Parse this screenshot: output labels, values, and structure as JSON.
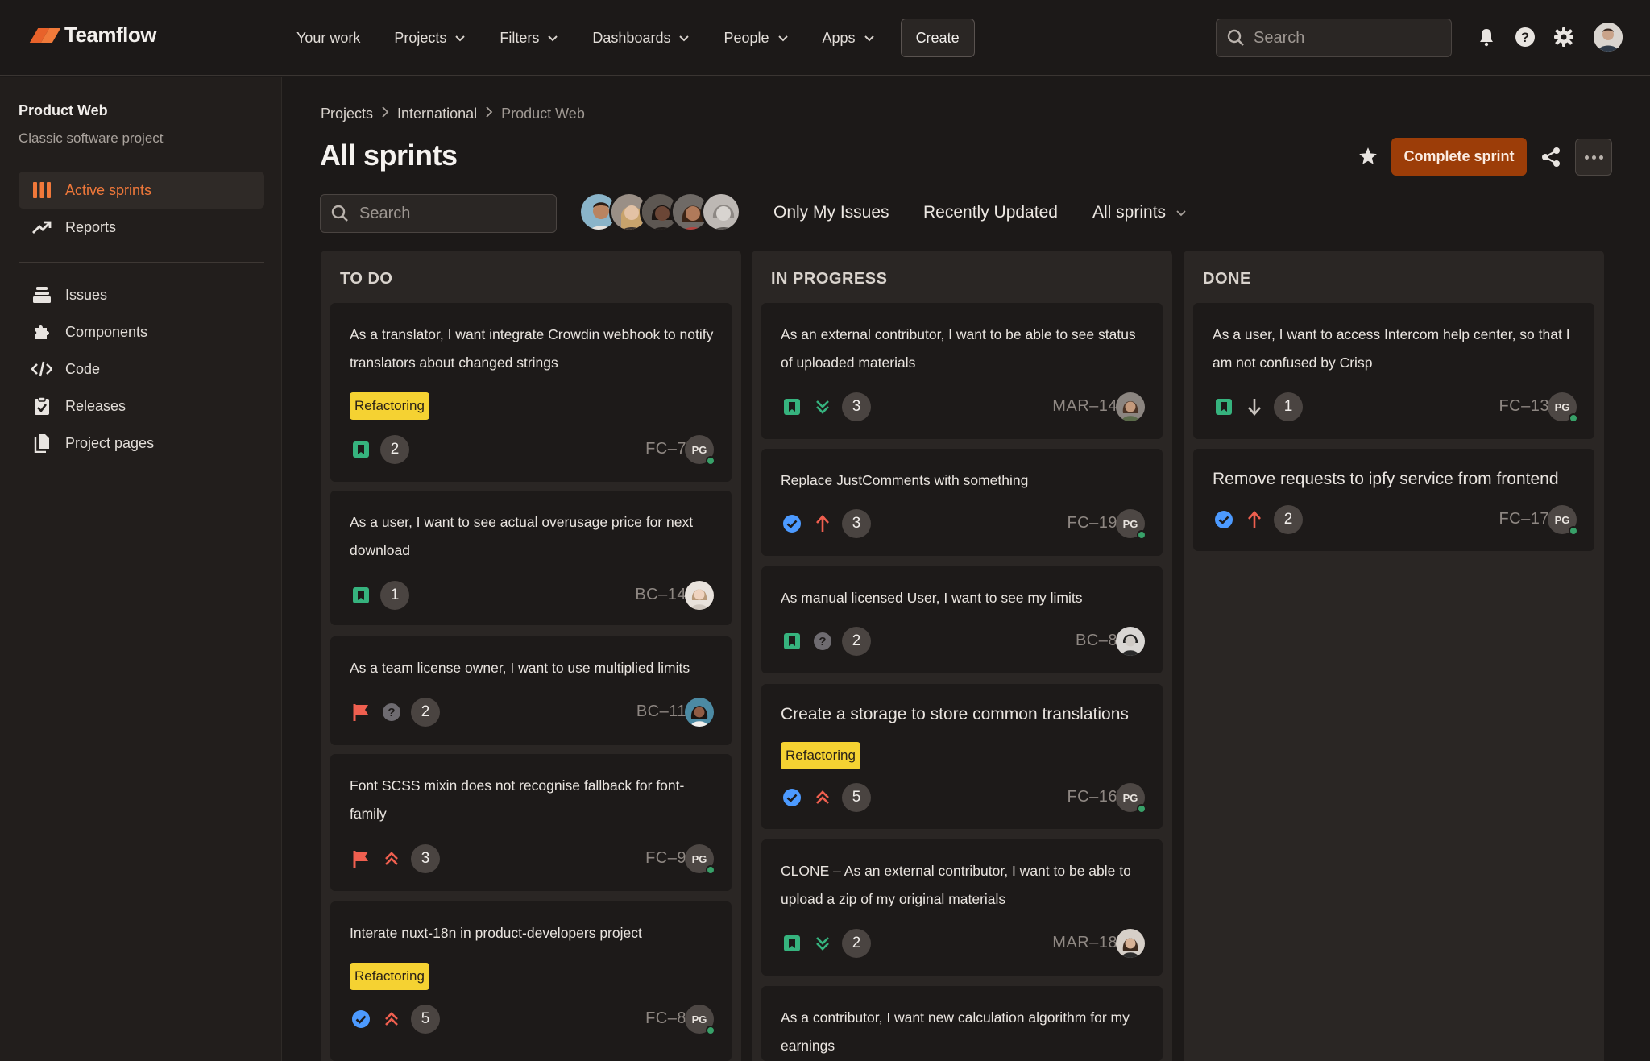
{
  "app": {
    "name": "Teamflow"
  },
  "nav": {
    "items": [
      {
        "label": "Your work"
      },
      {
        "label": "Projects"
      },
      {
        "label": "Filters"
      },
      {
        "label": "Dashboards"
      },
      {
        "label": "People"
      },
      {
        "label": "Apps"
      }
    ],
    "create_label": "Create",
    "search_placeholder": "Search"
  },
  "sidebar": {
    "project_name": "Product Web",
    "project_type": "Classic software project",
    "items": [
      {
        "label": "Active sprints",
        "icon": "board-columns-icon",
        "active": true
      },
      {
        "label": "Reports",
        "icon": "trend-up-icon"
      },
      {
        "label": "Issues",
        "icon": "stack-icon"
      },
      {
        "label": "Components",
        "icon": "puzzle-icon"
      },
      {
        "label": "Code",
        "icon": "code-icon"
      },
      {
        "label": "Releases",
        "icon": "clipboard-check-icon"
      },
      {
        "label": "Project pages",
        "icon": "pages-icon"
      }
    ]
  },
  "breadcrumb": [
    "Projects",
    "International",
    "Product Web"
  ],
  "page": {
    "title": "All sprints",
    "complete_label": "Complete sprint",
    "search_placeholder": "Search",
    "filters": {
      "only_my_issues": "Only My Issues",
      "recently_updated": "Recently Updated",
      "sprints_select": "All sprints"
    }
  },
  "colors": {
    "accent": "#e8622a",
    "complete_button": "#9c3d08",
    "tag": "#f5d232",
    "story": "#36b37e",
    "task": "#4c9aff",
    "bug": "#ef5f4f",
    "online": "#38a169"
  },
  "columns": [
    {
      "title": "TO DO",
      "cards": [
        {
          "title": "As a translator, I want integrate Crowdin webhook to notify translators about changed strings",
          "tag": "Refactoring",
          "type": "story",
          "priority": "",
          "count": "2",
          "key": "FC–7",
          "assignee": "PG"
        },
        {
          "title": "As a user, I want to see actual overusage price for next download",
          "tag": "",
          "type": "story",
          "priority": "",
          "count": "1",
          "key": "BC–14",
          "assignee": "face"
        },
        {
          "title": "As a team license owner, I want to use multiplied limits",
          "tag": "",
          "type": "bug-flag",
          "priority": "unknown",
          "count": "2",
          "key": "BC–11",
          "assignee": "face"
        },
        {
          "title": "Font SCSS mixin does not recognise fallback for font-family",
          "tag": "",
          "type": "bug-flag",
          "priority": "highest",
          "count": "3",
          "key": "FC–9",
          "assignee": "PG"
        },
        {
          "title": "Interate nuxt-18n in product-developers project",
          "tag": "Refactoring",
          "type": "task",
          "priority": "highest",
          "count": "5",
          "key": "FC–8",
          "assignee": "PG"
        }
      ]
    },
    {
      "title": "IN PROGRESS",
      "cards": [
        {
          "title": "As an external contributor, I want to be able to see status of uploaded materials",
          "tag": "",
          "type": "story",
          "priority": "lowest",
          "count": "3",
          "key": "MAR–14",
          "assignee": "face"
        },
        {
          "title": "Replace JustComments with something",
          "tag": "",
          "type": "task",
          "priority": "high",
          "count": "3",
          "key": "FC–19",
          "assignee": "PG"
        },
        {
          "title": "As manual licensed User, I want to see my limits",
          "tag": "",
          "type": "story",
          "priority": "unknown",
          "count": "2",
          "key": "BC–8",
          "assignee": "face"
        },
        {
          "title": "Create a storage to store common translations",
          "tag": "Refactoring",
          "type": "task",
          "priority": "highest",
          "count": "5",
          "key": "FC–16",
          "assignee": "PG"
        },
        {
          "title": "CLONE – As an external contributor, I want to be able to upload a zip of my original materials",
          "tag": "",
          "type": "story",
          "priority": "lowest",
          "count": "2",
          "key": "MAR–18",
          "assignee": "face"
        },
        {
          "title": "As a contributor, I want new calculation algorithm for my earnings",
          "tag": "",
          "type": "",
          "priority": "",
          "count": "",
          "key": "",
          "assignee": ""
        }
      ]
    },
    {
      "title": "DONE",
      "cards": [
        {
          "title": "As a user, I want to access Intercom help center, so that I am not confused by Crisp",
          "tag": "",
          "type": "story",
          "priority": "low",
          "count": "1",
          "key": "FC–13",
          "assignee": "PG"
        },
        {
          "title": "Remove requests to ipfy service from frontend",
          "tag": "",
          "type": "task",
          "priority": "high",
          "count": "2",
          "key": "FC–17",
          "assignee": "PG"
        }
      ]
    }
  ]
}
